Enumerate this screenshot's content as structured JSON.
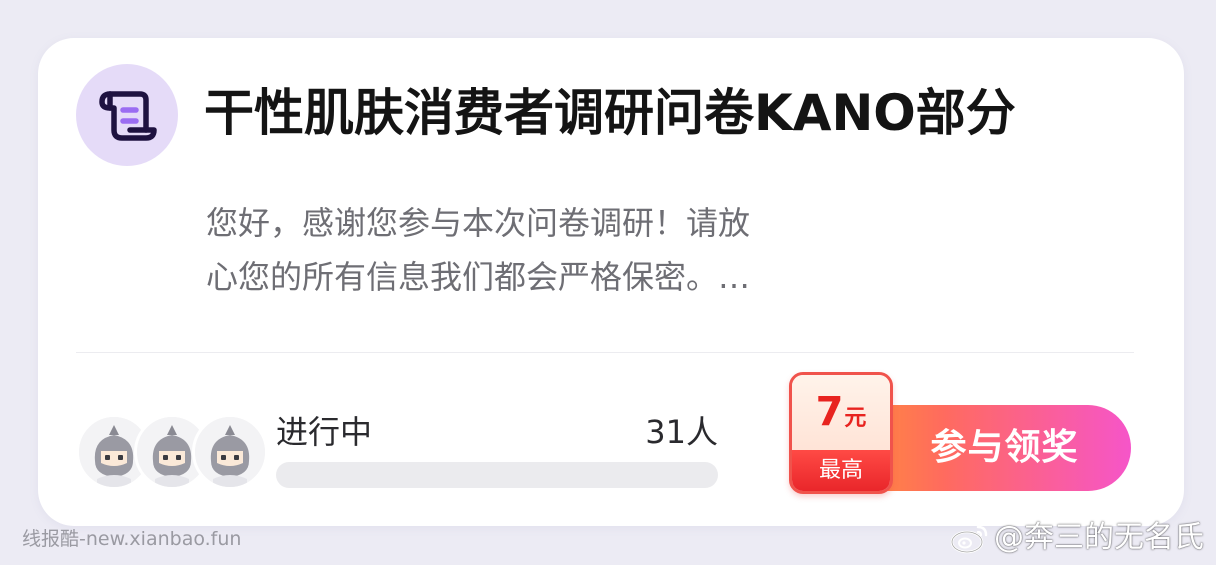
{
  "card": {
    "title": "干性肌肤消费者调研问卷KANO部分",
    "description_line1": "您好，感谢您参与本次问卷调研！请放",
    "description_line2": "心您的所有信息我们都会严格保密。…",
    "icon": "scroll-document-icon"
  },
  "participants": {
    "status": "进行中",
    "count": "31人",
    "avatars": [
      "ninja-avatar",
      "ninja-avatar",
      "ninja-avatar"
    ],
    "progress": 0
  },
  "reward": {
    "amount": "7",
    "unit": "元",
    "caption": "最高"
  },
  "action": {
    "join_label": "参与领奖"
  },
  "watermarks": {
    "left": "线报酷-new.xianbao.fun",
    "right": "@奔三的无名氏",
    "right_icon": "weibo-icon"
  },
  "colors": {
    "accent_purple": "#e5dbf8",
    "button_start": "#ff9a2e",
    "button_end": "#f655c9",
    "reward_red": "#e8231f"
  }
}
